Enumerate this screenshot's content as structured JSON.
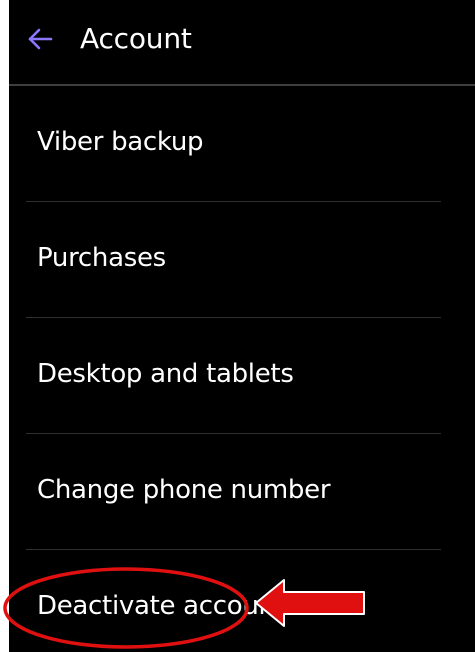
{
  "header": {
    "title": "Account",
    "back_icon": "arrow-left-icon",
    "accent_color": "#8b78ff"
  },
  "menu": {
    "items": [
      {
        "label": "Viber backup"
      },
      {
        "label": "Purchases"
      },
      {
        "label": "Desktop and tablets"
      },
      {
        "label": "Change phone number"
      },
      {
        "label": "Deactivate account"
      }
    ]
  },
  "annotation": {
    "highlight_color": "#e01010",
    "shapes": [
      "ellipse",
      "arrow-left"
    ]
  }
}
